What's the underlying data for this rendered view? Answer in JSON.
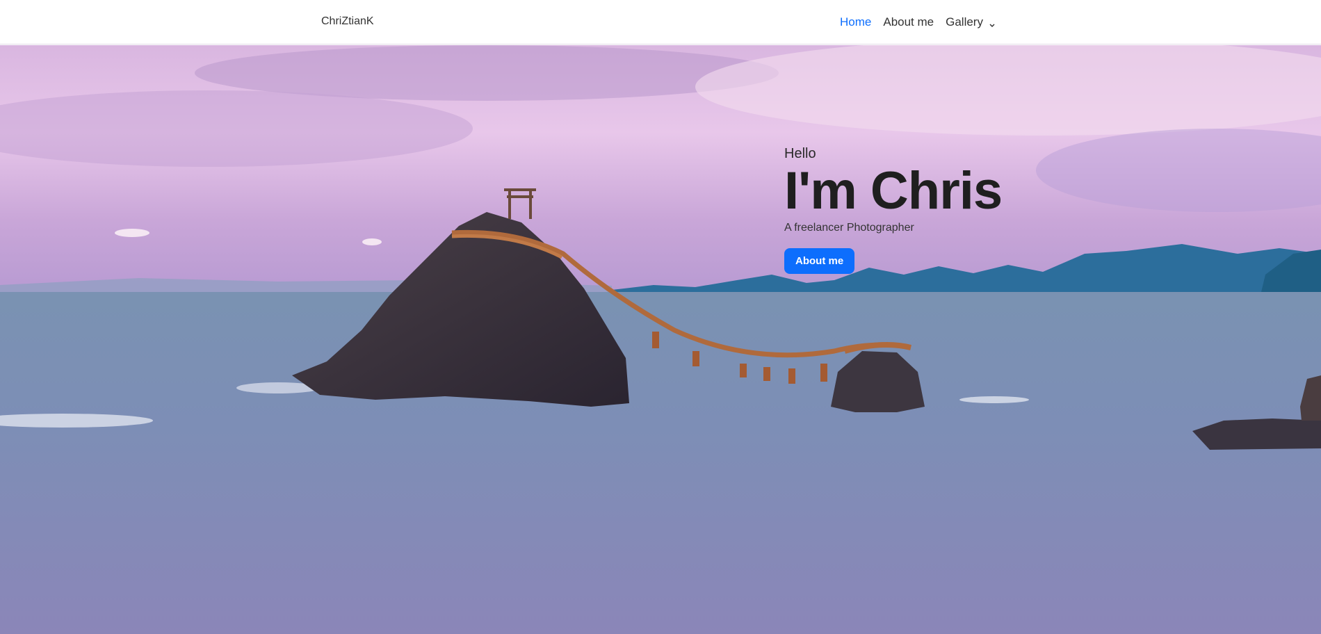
{
  "navbar": {
    "brand": "ChriZtianK",
    "links": [
      {
        "label": "Home",
        "active": true
      },
      {
        "label": "About me",
        "active": false
      },
      {
        "label": "Gallery",
        "active": false,
        "dropdown": true
      }
    ]
  },
  "hero": {
    "greeting": "Hello",
    "headline": "I'm Chris",
    "tagline": "A freelancer Photographer",
    "cta_label": "About me",
    "background_image": "meoto-iwa-wedded-rocks-seascape"
  },
  "colors": {
    "accent": "#0d6efd",
    "text": "#1f1f1f"
  }
}
